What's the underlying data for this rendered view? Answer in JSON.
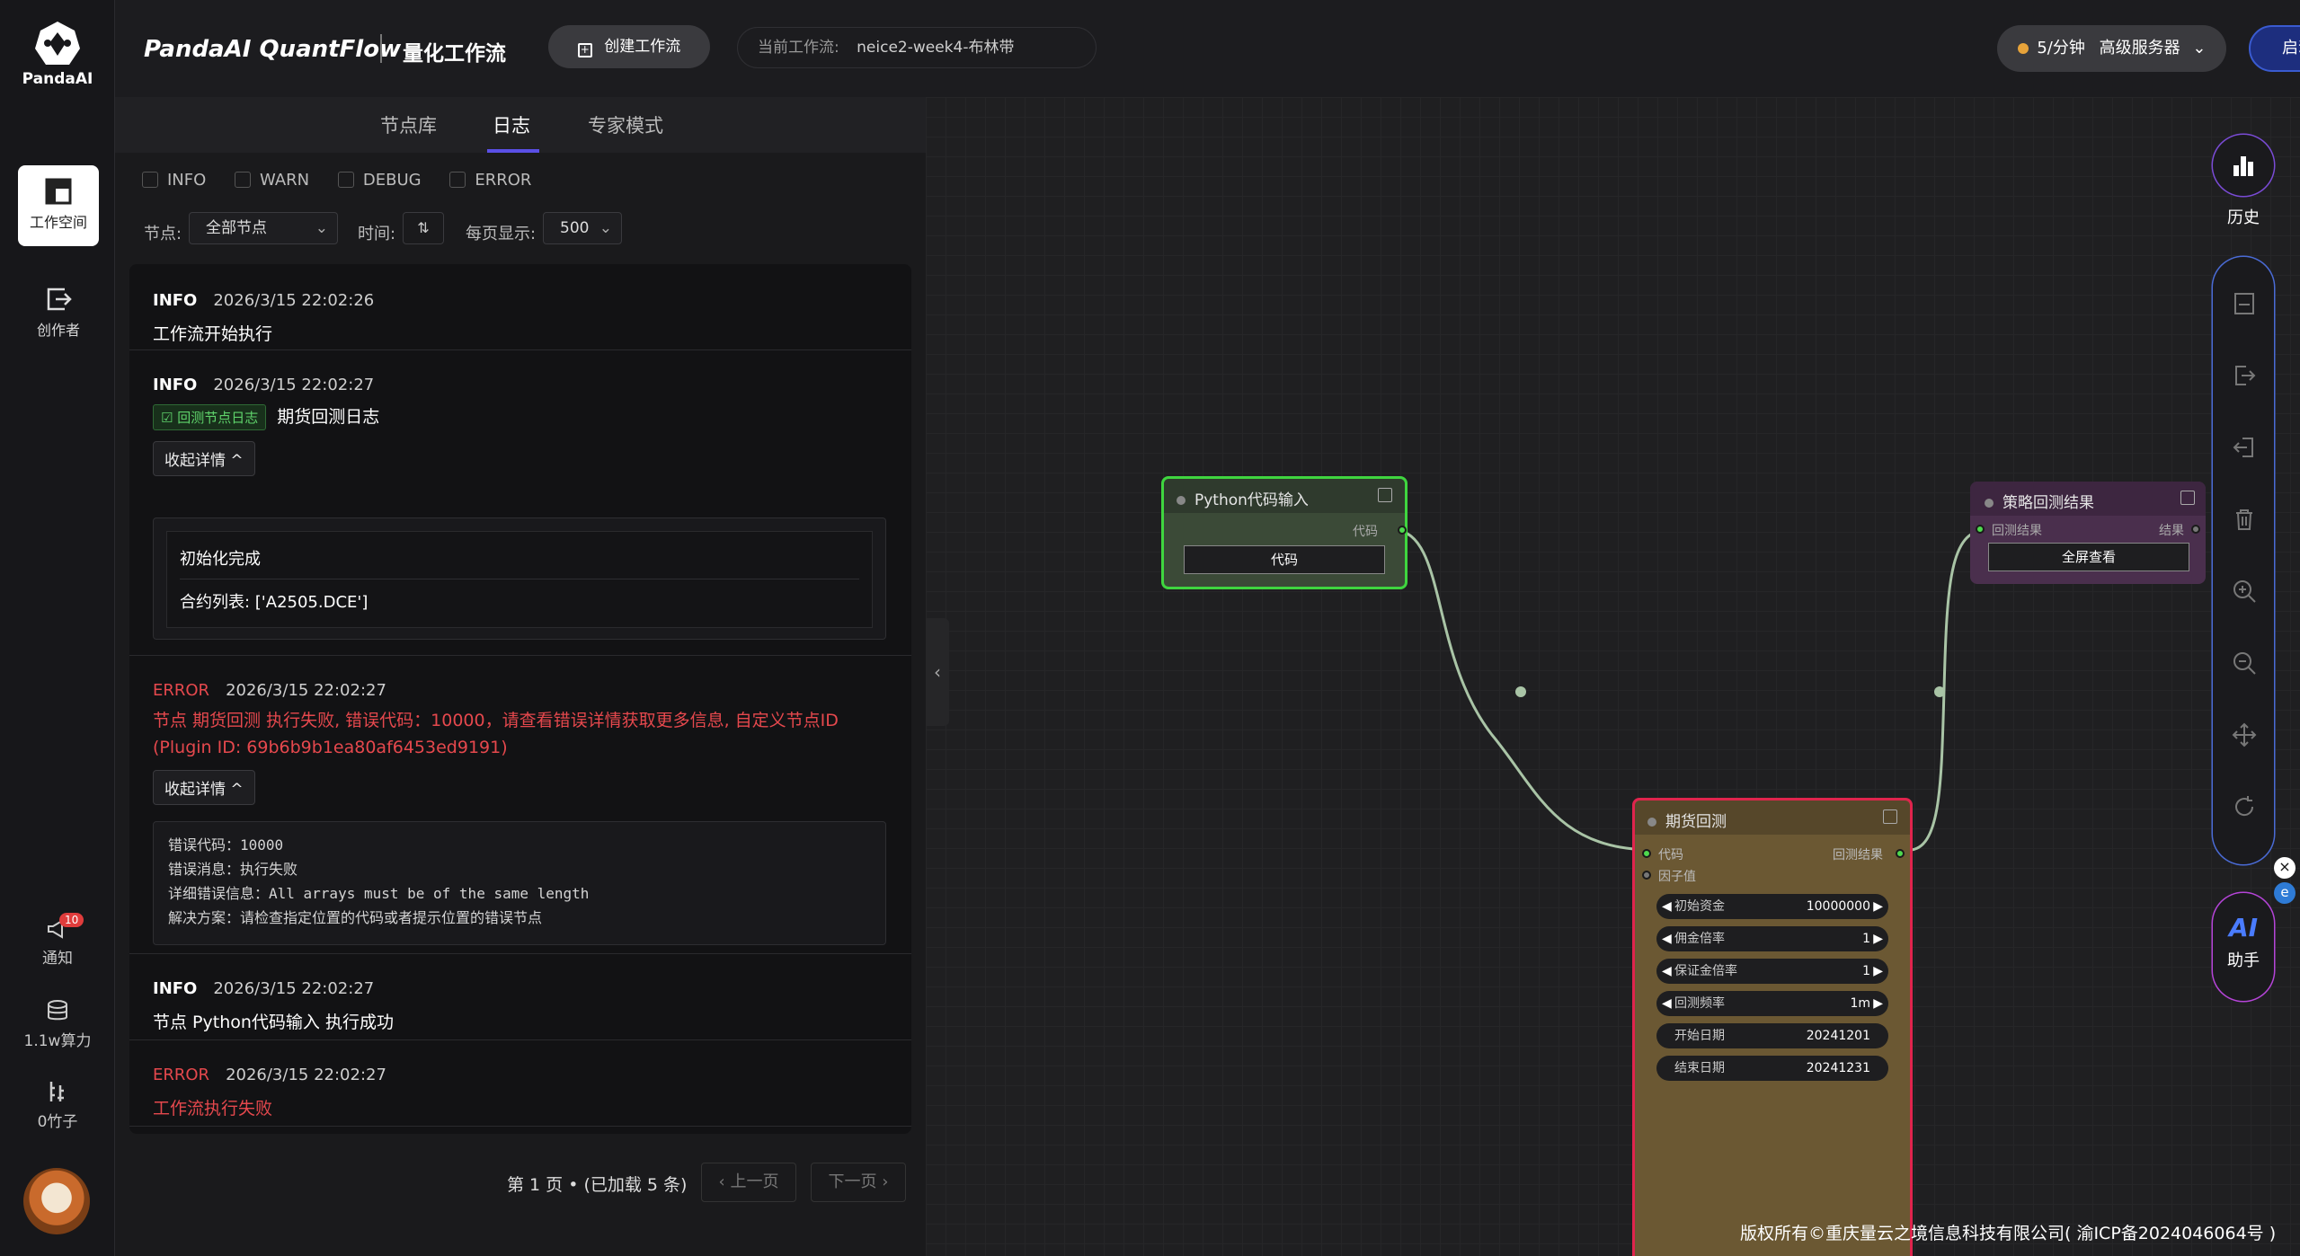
{
  "brand": {
    "logo_text": "PandaAI",
    "name": "PandaAI QuantFlow",
    "subtitle": "量化工作流"
  },
  "header": {
    "create_label": "创建工作流",
    "current_flow_label": "当前工作流:",
    "current_flow_value": "neice2-week4-布林带",
    "rate": "5/分钟",
    "server": "高级服务器",
    "start_label": "启动工作流"
  },
  "rail": {
    "workspace": "工作空间",
    "creator": "创作者",
    "notify": "通知",
    "notify_badge": "10",
    "compute": "1.1w算力",
    "bamboo": "0竹子"
  },
  "tabs": [
    "节点库",
    "日志",
    "专家模式"
  ],
  "filters": {
    "levels": [
      "INFO",
      "WARN",
      "DEBUG",
      "ERROR"
    ],
    "node_label": "节点:",
    "node_value": "全部节点",
    "time_label": "时间:",
    "per_page_label": "每页显示:",
    "per_page_value": "500"
  },
  "logs": [
    {
      "level": "INFO",
      "time": "2026/3/15 22:02:26",
      "message": "工作流开始执行"
    },
    {
      "level": "INFO",
      "time": "2026/3/15 22:02:27",
      "tag": "回测节点日志",
      "message": "期货回测日志",
      "detail_btn": "收起详情",
      "details": [
        "初始化完成",
        "合约列表: ['A2505.DCE']"
      ]
    },
    {
      "level": "ERROR",
      "time": "2026/3/15 22:02:27",
      "message": "节点 期货回测 执行失败, 错误代码：10000，请查看错误详情获取更多信息, 自定义节点ID",
      "message2": "(Plugin ID: 69b6b9b1ea80af6453ed9191)",
      "detail_btn": "收起详情",
      "details": [
        "错误代码：10000",
        "错误消息：执行失败",
        "详细错误信息：All arrays must be of the same length",
        "解决方案：请检查指定位置的代码或者提示位置的错误节点"
      ]
    },
    {
      "level": "INFO",
      "time": "2026/3/15 22:02:27",
      "message": "节点 Python代码输入 执行成功"
    },
    {
      "level": "ERROR",
      "time": "2026/3/15 22:02:27",
      "message": "工作流执行失败"
    }
  ],
  "pager": {
    "info": "第 1 页 • (已加载 5 条)",
    "prev": "上一页",
    "next": "下一页"
  },
  "nodes": {
    "python": {
      "title": "Python代码输入",
      "out_port": "代码",
      "button": "代码"
    },
    "result": {
      "title": "策略回测结果",
      "in_port": "回测结果",
      "out_port": "结果",
      "button": "全屏查看"
    },
    "futures": {
      "title": "期货回测",
      "in_code": "代码",
      "in_factor": "因子值",
      "out_port": "回测结果",
      "params": [
        {
          "label": "初始资金",
          "value": "10000000",
          "arrows": true
        },
        {
          "label": "佣金倍率",
          "value": "1",
          "arrows": true
        },
        {
          "label": "保证金倍率",
          "value": "1",
          "arrows": true
        },
        {
          "label": "回测频率",
          "value": "1m",
          "arrows": true
        },
        {
          "label": "开始日期",
          "value": "20241201",
          "arrows": false
        },
        {
          "label": "结束日期",
          "value": "20241231",
          "arrows": false
        }
      ]
    }
  },
  "right_tools": {
    "history": "历史",
    "assistant": "助手",
    "ai": "AI"
  },
  "colors": {
    "python_border": "#3fd53f",
    "futures_border": "#e0244d",
    "futures_bg": "#6b5833",
    "result_bg": "#4a2f4d",
    "error": "#e5484d",
    "accent": "#5a4fe6"
  },
  "copyright": "版权所有©重庆量云之境信息科技有限公司( 渝ICP备2024046064号 )"
}
